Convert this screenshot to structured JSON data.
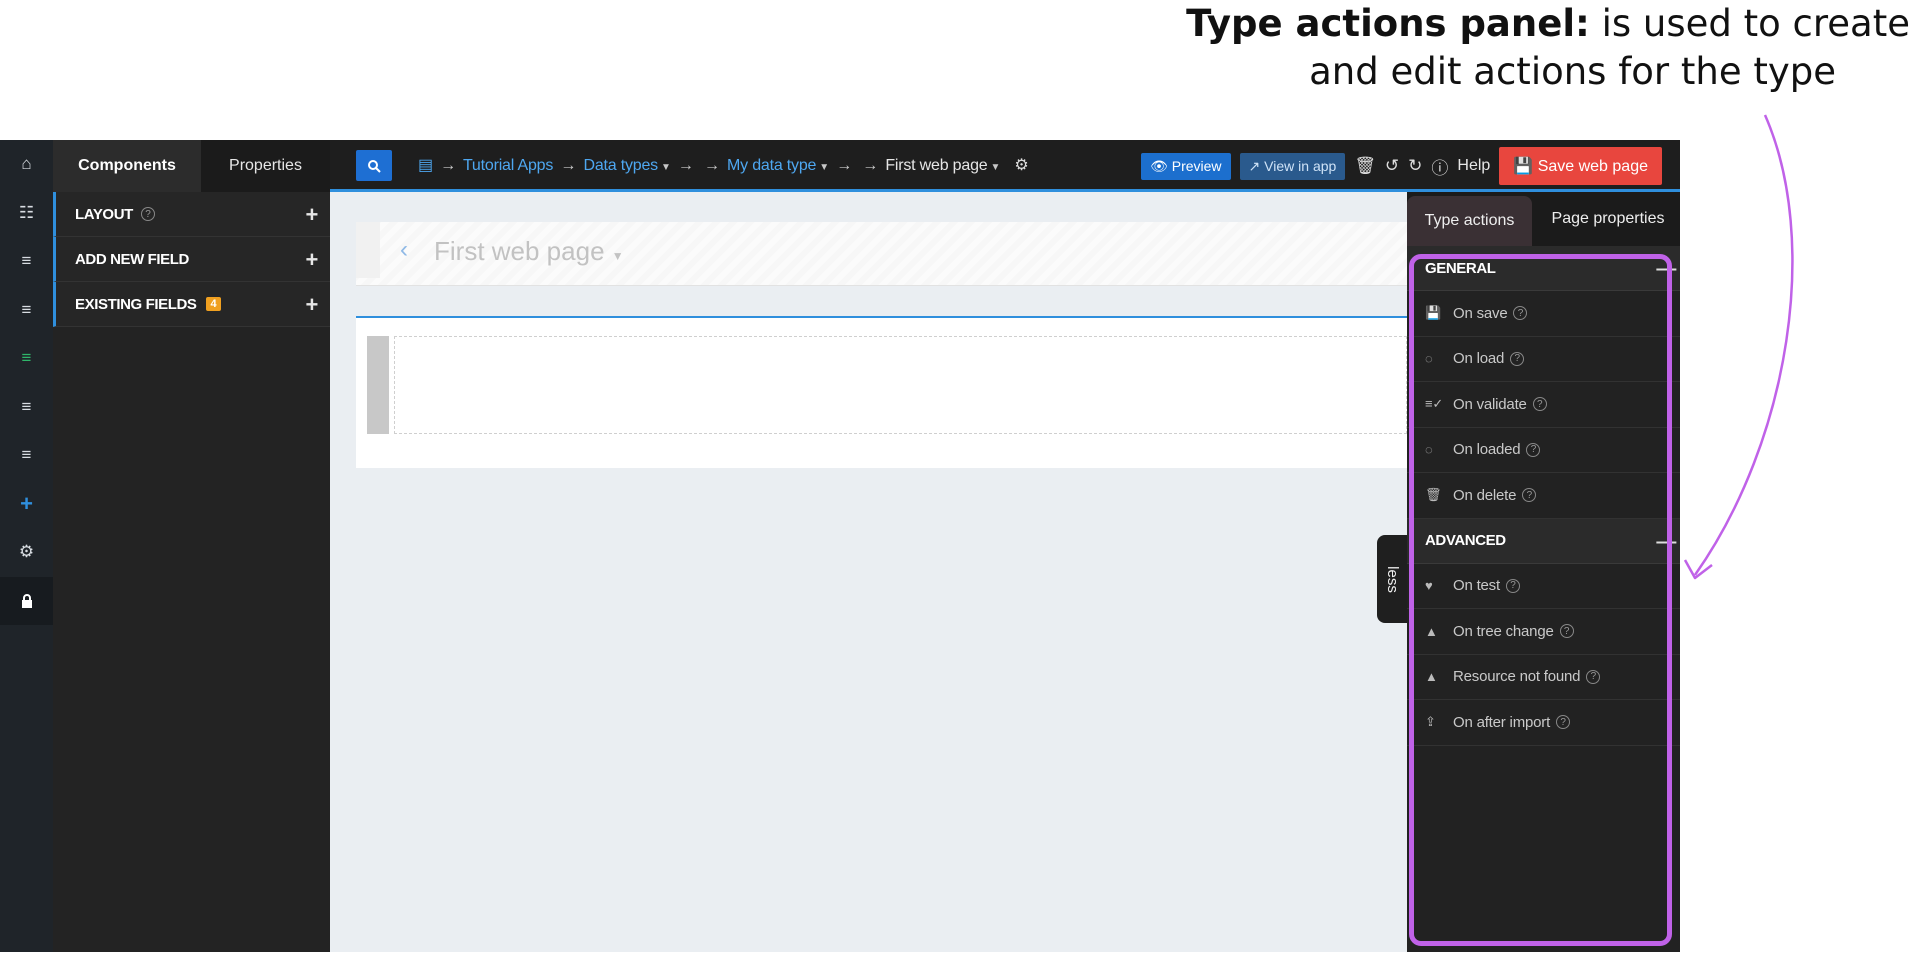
{
  "annotation": {
    "bold": "Type actions panel:",
    "line1_rest": " is used to create",
    "line2": "and edit actions for the type"
  },
  "left_sidebar": {
    "items": [
      "home-icon",
      "sitemap-icon",
      "list-icon",
      "list-icon",
      "list-icon-green",
      "list-icon",
      "list-icon",
      "plus-icon",
      "gear-icon",
      "lock-icon"
    ]
  },
  "components_panel": {
    "tabs": [
      "Components",
      "Properties"
    ],
    "sections": [
      {
        "label": "LAYOUT",
        "help": "?",
        "action": "+"
      },
      {
        "label": "ADD NEW FIELD",
        "action": "+"
      },
      {
        "label": "EXISTING FIELDS",
        "badge": "4",
        "action": "+"
      }
    ]
  },
  "topbar": {
    "breadcrumb": {
      "arrow": "→",
      "items": [
        "Tutorial Apps",
        "Data types",
        "My data type",
        "First web page"
      ]
    },
    "preview_label": "Preview",
    "view_in_app_label": "View in app",
    "help_label": "Help",
    "save_label": "Save web page"
  },
  "canvas": {
    "page_title": "First web page"
  },
  "less_tab": "less",
  "right_panel": {
    "tabs": [
      "Type actions",
      "Page properties"
    ],
    "general": {
      "title": "GENERAL",
      "items": [
        "On save",
        "On load",
        "On validate",
        "On loaded",
        "On delete"
      ]
    },
    "advanced": {
      "title": "ADVANCED",
      "items": [
        "On test",
        "On tree change",
        "Resource not found",
        "On after import"
      ]
    }
  },
  "colors": {
    "accent_blue": "#2f8fdd",
    "save_red": "#e8463e",
    "highlight_purple": "#c062e8",
    "badge_orange": "#f0a020"
  }
}
